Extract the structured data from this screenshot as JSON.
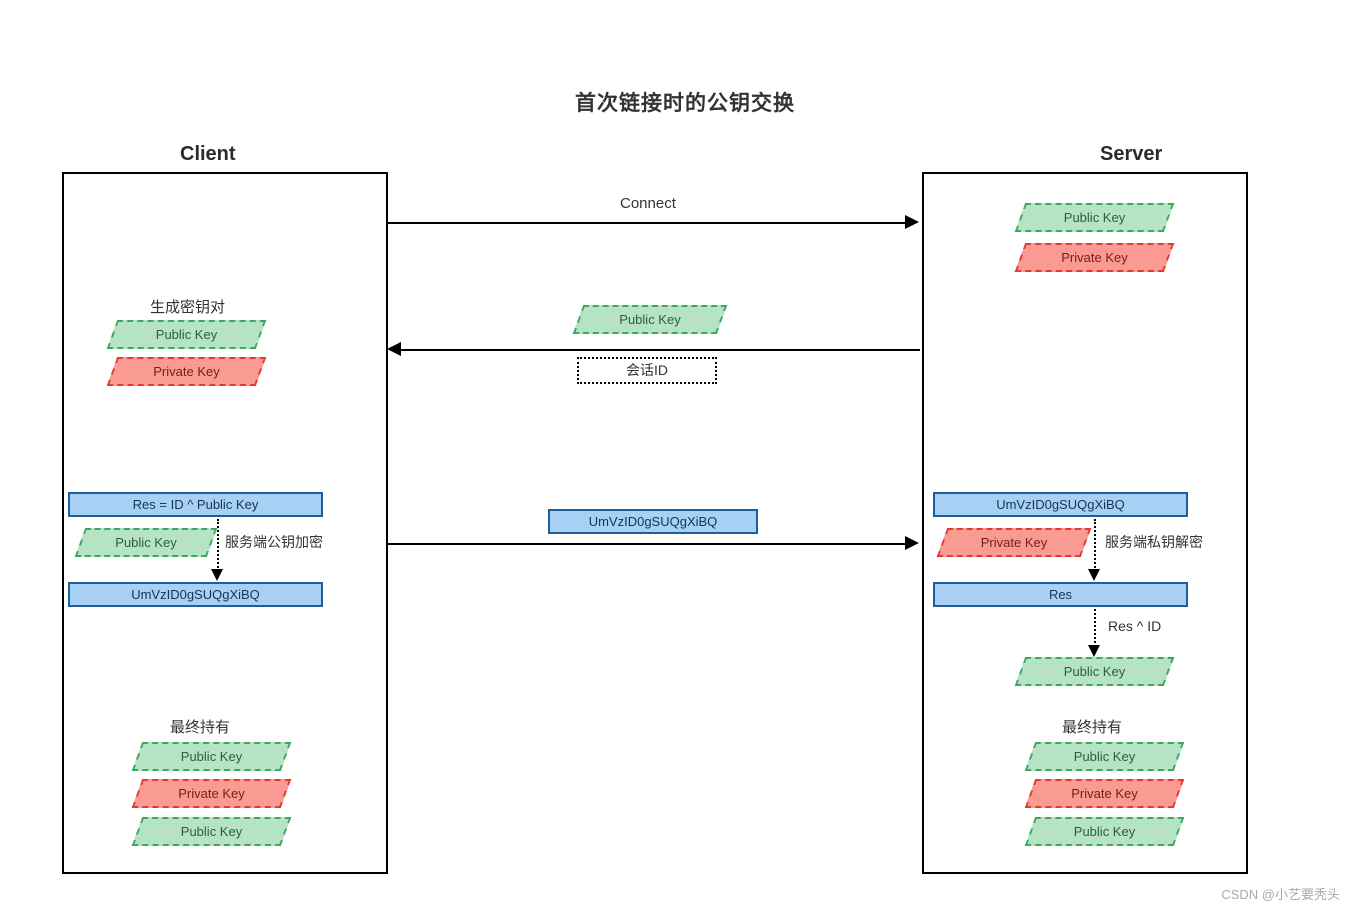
{
  "title": "首次链接时的公钥交换",
  "labels": {
    "client": "Client",
    "server": "Server",
    "public_key": "Public Key",
    "private_key": "Private Key",
    "gen_keypair": "生成密钥对",
    "session_id": "会话ID",
    "res_formula": "Res = ID ^ Public Key",
    "encoded": "UmVzID0gSUQgXiBQ",
    "enc_note_left": "服务端公钥加密",
    "dec_note_right": "服务端私钥解密",
    "res": "Res",
    "res_xor_id": "Res ^ ID",
    "final_hold": "最终持有",
    "connect": "Connect"
  },
  "attribution": "CSDN @小艺要秃头"
}
